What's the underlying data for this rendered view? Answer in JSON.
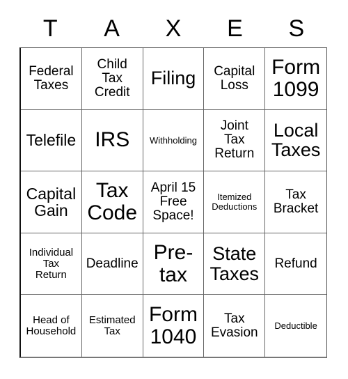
{
  "card": {
    "title_letters": [
      "T",
      "A",
      "X",
      "E",
      "S"
    ],
    "grid": {
      "rows": 5,
      "columns": 5,
      "cells": [
        {
          "text": "Federal\nTaxes",
          "size": "md",
          "free": false
        },
        {
          "text": "Child\nTax\nCredit",
          "size": "md",
          "free": false
        },
        {
          "text": "Filing",
          "size": "xl",
          "free": false
        },
        {
          "text": "Capital\nLoss",
          "size": "md",
          "free": false
        },
        {
          "text": "Form\n1099",
          "size": "xxl",
          "free": false
        },
        {
          "text": "Telefile",
          "size": "lg",
          "free": false
        },
        {
          "text": "IRS",
          "size": "xxl",
          "free": false
        },
        {
          "text": "Withholding",
          "size": "xs",
          "free": false
        },
        {
          "text": "Joint\nTax\nReturn",
          "size": "md",
          "free": false
        },
        {
          "text": "Local\nTaxes",
          "size": "xl",
          "free": false
        },
        {
          "text": "Capital\nGain",
          "size": "lg",
          "free": false
        },
        {
          "text": "Tax\nCode",
          "size": "xxl",
          "free": false
        },
        {
          "text": "April 15\nFree\nSpace!",
          "size": "md",
          "free": true
        },
        {
          "text": "Itemized\nDeductions",
          "size": "xs",
          "free": false
        },
        {
          "text": "Tax\nBracket",
          "size": "md",
          "free": false
        },
        {
          "text": "Individual\nTax\nReturn",
          "size": "sm",
          "free": false
        },
        {
          "text": "Deadline",
          "size": "md",
          "free": false
        },
        {
          "text": "Pre-\ntax",
          "size": "xxl",
          "free": false
        },
        {
          "text": "State\nTaxes",
          "size": "xl",
          "free": false
        },
        {
          "text": "Refund",
          "size": "md",
          "free": false
        },
        {
          "text": "Head of\nHousehold",
          "size": "sm",
          "free": false
        },
        {
          "text": "Estimated\nTax",
          "size": "sm",
          "free": false
        },
        {
          "text": "Form\n1040",
          "size": "xxl",
          "free": false
        },
        {
          "text": "Tax\nEvasion",
          "size": "md",
          "free": false
        },
        {
          "text": "Deductible",
          "size": "xs",
          "free": false
        }
      ]
    }
  },
  "colors": {
    "background": "#ffffff",
    "text": "#000000",
    "grid_line": "#666666",
    "grid_outer": "#111111"
  }
}
